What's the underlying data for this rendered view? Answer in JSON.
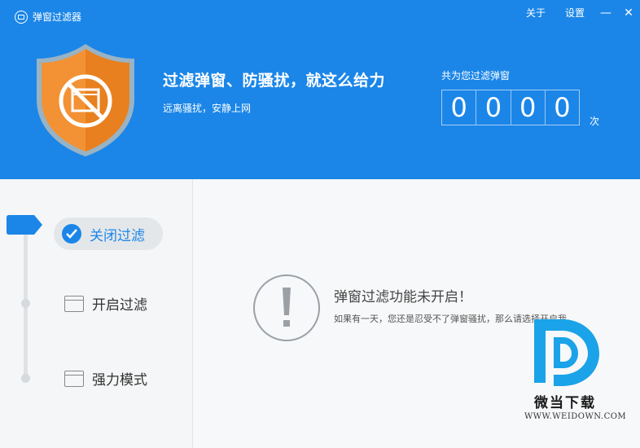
{
  "window": {
    "title": "弹窗过滤器",
    "menu": {
      "about": "关于",
      "settings": "设置"
    },
    "minimize_glyph": "—",
    "close_glyph": "✕"
  },
  "header": {
    "headline": "过滤弹窗、防骚扰，就这么给力",
    "subline": "远离骚扰，安静上网",
    "counter_label": "共为您过滤弹窗",
    "counter_digits": [
      "0",
      "0",
      "0",
      "0"
    ],
    "counter_unit": "次"
  },
  "sidebar": {
    "items": [
      {
        "label": "关闭过滤",
        "icon": "check-circle-icon",
        "active": true
      },
      {
        "label": "开启过滤",
        "icon": "window-icon",
        "active": false
      },
      {
        "label": "强力模式",
        "icon": "window-stack-icon",
        "active": false
      }
    ]
  },
  "main": {
    "status_title": "弹窗过滤功能未开启！",
    "status_desc": "如果有一天，您还是忍受不了弹窗骚扰，那么请选择开启我。"
  },
  "watermark": {
    "text": "微当下载",
    "url": "WWW.WEIDOWN.COM"
  },
  "colors": {
    "accent": "#1b86e8",
    "shield_orange": "#f39234",
    "background": "#f5f6f7"
  }
}
